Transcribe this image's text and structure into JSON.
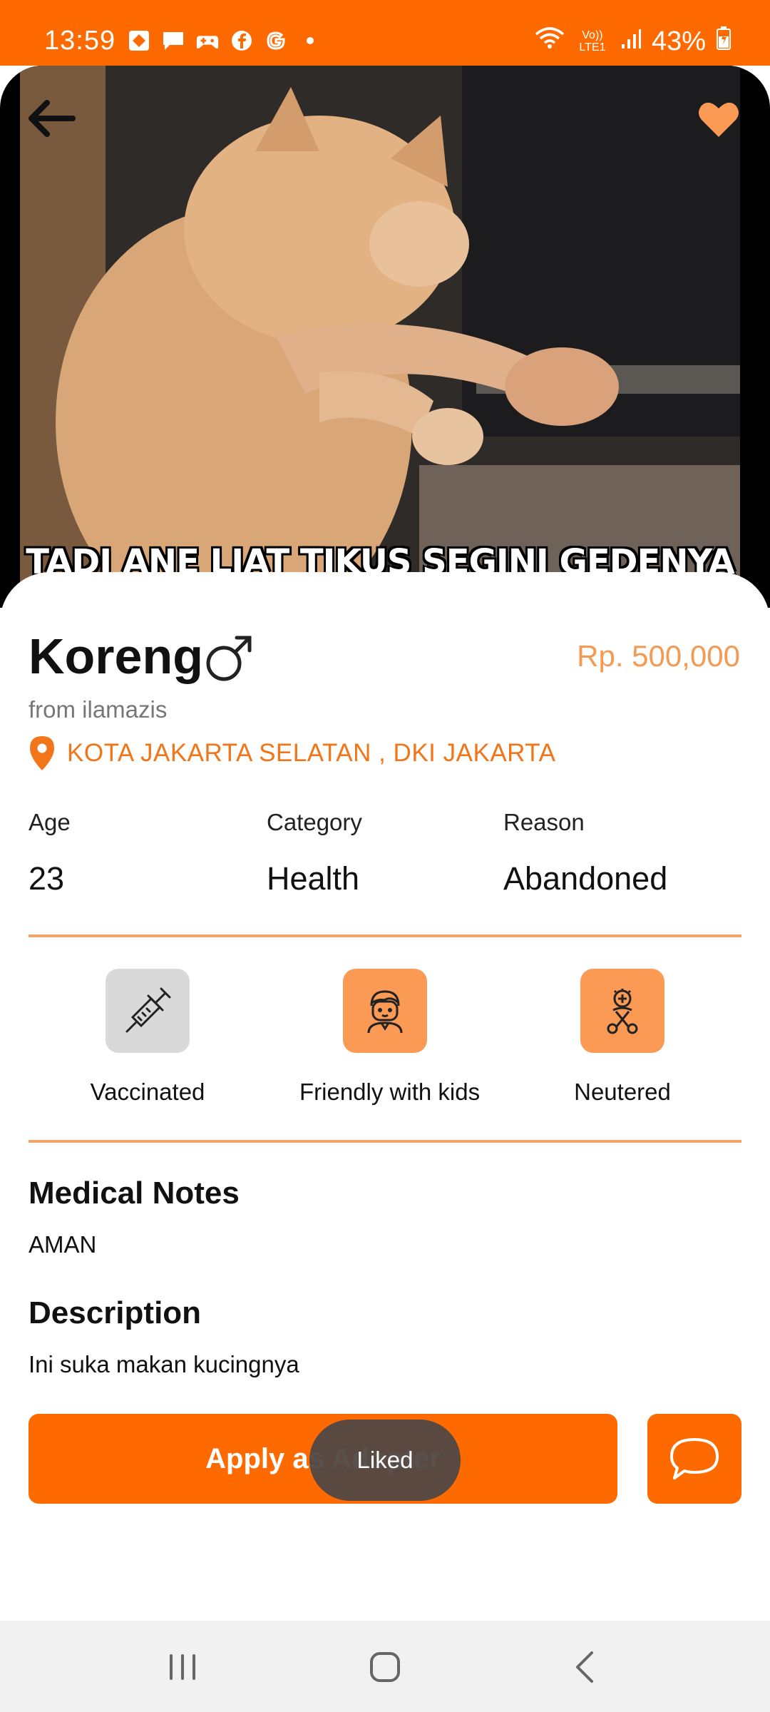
{
  "status_bar": {
    "time": "13:59",
    "battery": "43%",
    "network": "Vo)) LTE1",
    "icons": [
      "app-icon",
      "message-icon",
      "gamepad-icon",
      "facebook-icon",
      "google-icon",
      "dot-icon",
      "wifi-icon",
      "signal-icon",
      "battery-icon"
    ]
  },
  "hero": {
    "caption": "TADI ANE LIAT TIKUS SEGINI GEDENYA",
    "liked": true
  },
  "pet": {
    "name": "Koreng",
    "gender": "male",
    "price": "Rp. 500,000",
    "owner": "from ilamazis",
    "location": "KOTA JAKARTA SELATAN , DKI JAKARTA"
  },
  "attributes": [
    {
      "label": "Age",
      "value": "23"
    },
    {
      "label": "Category",
      "value": "Health"
    },
    {
      "label": "Reason",
      "value": "Abandoned"
    }
  ],
  "features": [
    {
      "label": "Vaccinated",
      "icon": "syringe-icon",
      "active": false
    },
    {
      "label": "Friendly with kids",
      "icon": "kid-icon",
      "active": true
    },
    {
      "label": "Neutered",
      "icon": "neutered-icon",
      "active": true
    }
  ],
  "medical": {
    "title": "Medical Notes",
    "body": "AMAN"
  },
  "description": {
    "title": "Description",
    "body": "Ini suka makan kucingnya"
  },
  "actions": {
    "apply_label": "Apply as Adopter"
  },
  "toast": "Liked",
  "colors": {
    "accent": "#ff6a00",
    "accent_light": "#fb9a55",
    "price": "#f39a55",
    "divider": "#f2a46b",
    "inactive": "#d9d9d9"
  }
}
